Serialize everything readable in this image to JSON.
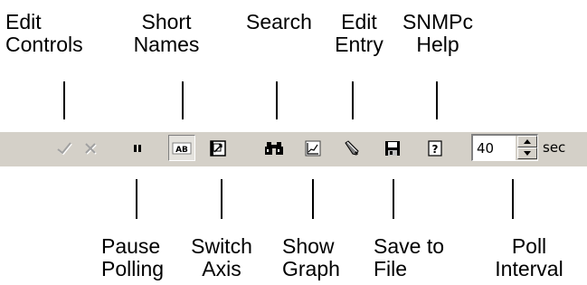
{
  "callouts": {
    "edit_controls": "Edit\nControls",
    "short_names": "Short\nNames",
    "search": "Search",
    "edit_entry": "Edit\nEntry",
    "snmpc_help": "SNMPc\nHelp",
    "pause_polling": "Pause\nPolling",
    "switch_axis": "Switch\nAxis",
    "show_graph": "Show\nGraph",
    "save_to_file": "Save to\nFile",
    "poll_interval": "Poll\nInterval"
  },
  "toolbar": {
    "buttons": [
      {
        "icon": "checkmark-icon",
        "state": "disabled"
      },
      {
        "icon": "close-icon",
        "state": "disabled"
      },
      {
        "icon": "pause-icon",
        "state": "normal"
      },
      {
        "icon": "short-names-icon",
        "state": "pressed"
      },
      {
        "icon": "switch-axis-icon",
        "state": "normal"
      },
      {
        "icon": "binoculars-icon",
        "state": "normal"
      },
      {
        "icon": "graph-icon",
        "state": "normal"
      },
      {
        "icon": "pencil-icon",
        "state": "normal"
      },
      {
        "icon": "floppy-disk-icon",
        "state": "normal"
      },
      {
        "icon": "help-icon",
        "state": "normal"
      }
    ],
    "poll_interval_value": "40",
    "poll_interval_unit": "sec"
  },
  "colors": {
    "toolbar_bg": "#d4d0c8",
    "disabled_icon": "#a0a0a0",
    "text": "#000000"
  }
}
